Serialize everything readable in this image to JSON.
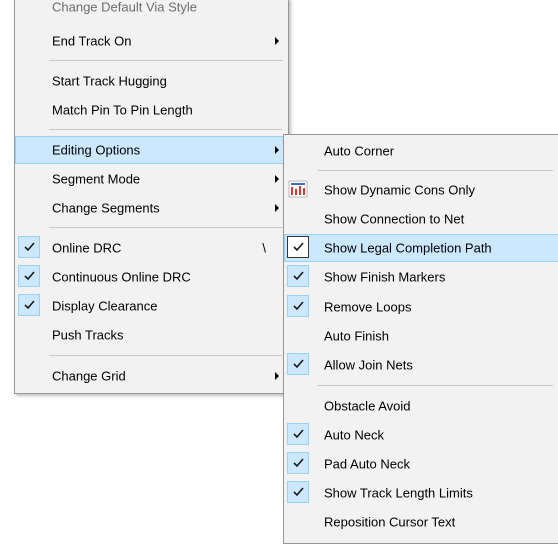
{
  "main_menu": {
    "items": [
      {
        "label": "Change Default Via Style"
      },
      {
        "label": "End Track On"
      },
      {
        "label": "Start Track Hugging"
      },
      {
        "label": "Match Pin To Pin Length"
      },
      {
        "label": "Editing Options"
      },
      {
        "label": "Segment Mode"
      },
      {
        "label": "Change Segments"
      },
      {
        "label": "Online DRC",
        "shortcut": "\\",
        "checked": true
      },
      {
        "label": "Continuous Online DRC",
        "checked": true
      },
      {
        "label": "Display Clearance",
        "checked": true
      },
      {
        "label": "Push Tracks"
      },
      {
        "label": "Change Grid"
      }
    ]
  },
  "sub_menu": {
    "items": [
      {
        "label": "Auto Corner"
      },
      {
        "label": "Show Dynamic Cons Only",
        "icon": "dynamic-cons-icon"
      },
      {
        "label": "Show Connection to Net"
      },
      {
        "label": "Show Legal Completion Path",
        "checked": true
      },
      {
        "label": "Show Finish Markers",
        "checked": true
      },
      {
        "label": "Remove Loops",
        "checked": true
      },
      {
        "label": "Auto Finish"
      },
      {
        "label": "Allow Join Nets",
        "checked": true
      },
      {
        "label": "Obstacle Avoid"
      },
      {
        "label": "Auto Neck",
        "checked": true
      },
      {
        "label": "Pad Auto Neck",
        "checked": true
      },
      {
        "label": "Show Track Length Limits",
        "checked": true
      },
      {
        "label": "Reposition Cursor Text"
      }
    ]
  },
  "colors": {
    "highlight": "#cce8ff",
    "highlight_border": "#99d1ff",
    "menu_bg": "#f2f2f2"
  }
}
